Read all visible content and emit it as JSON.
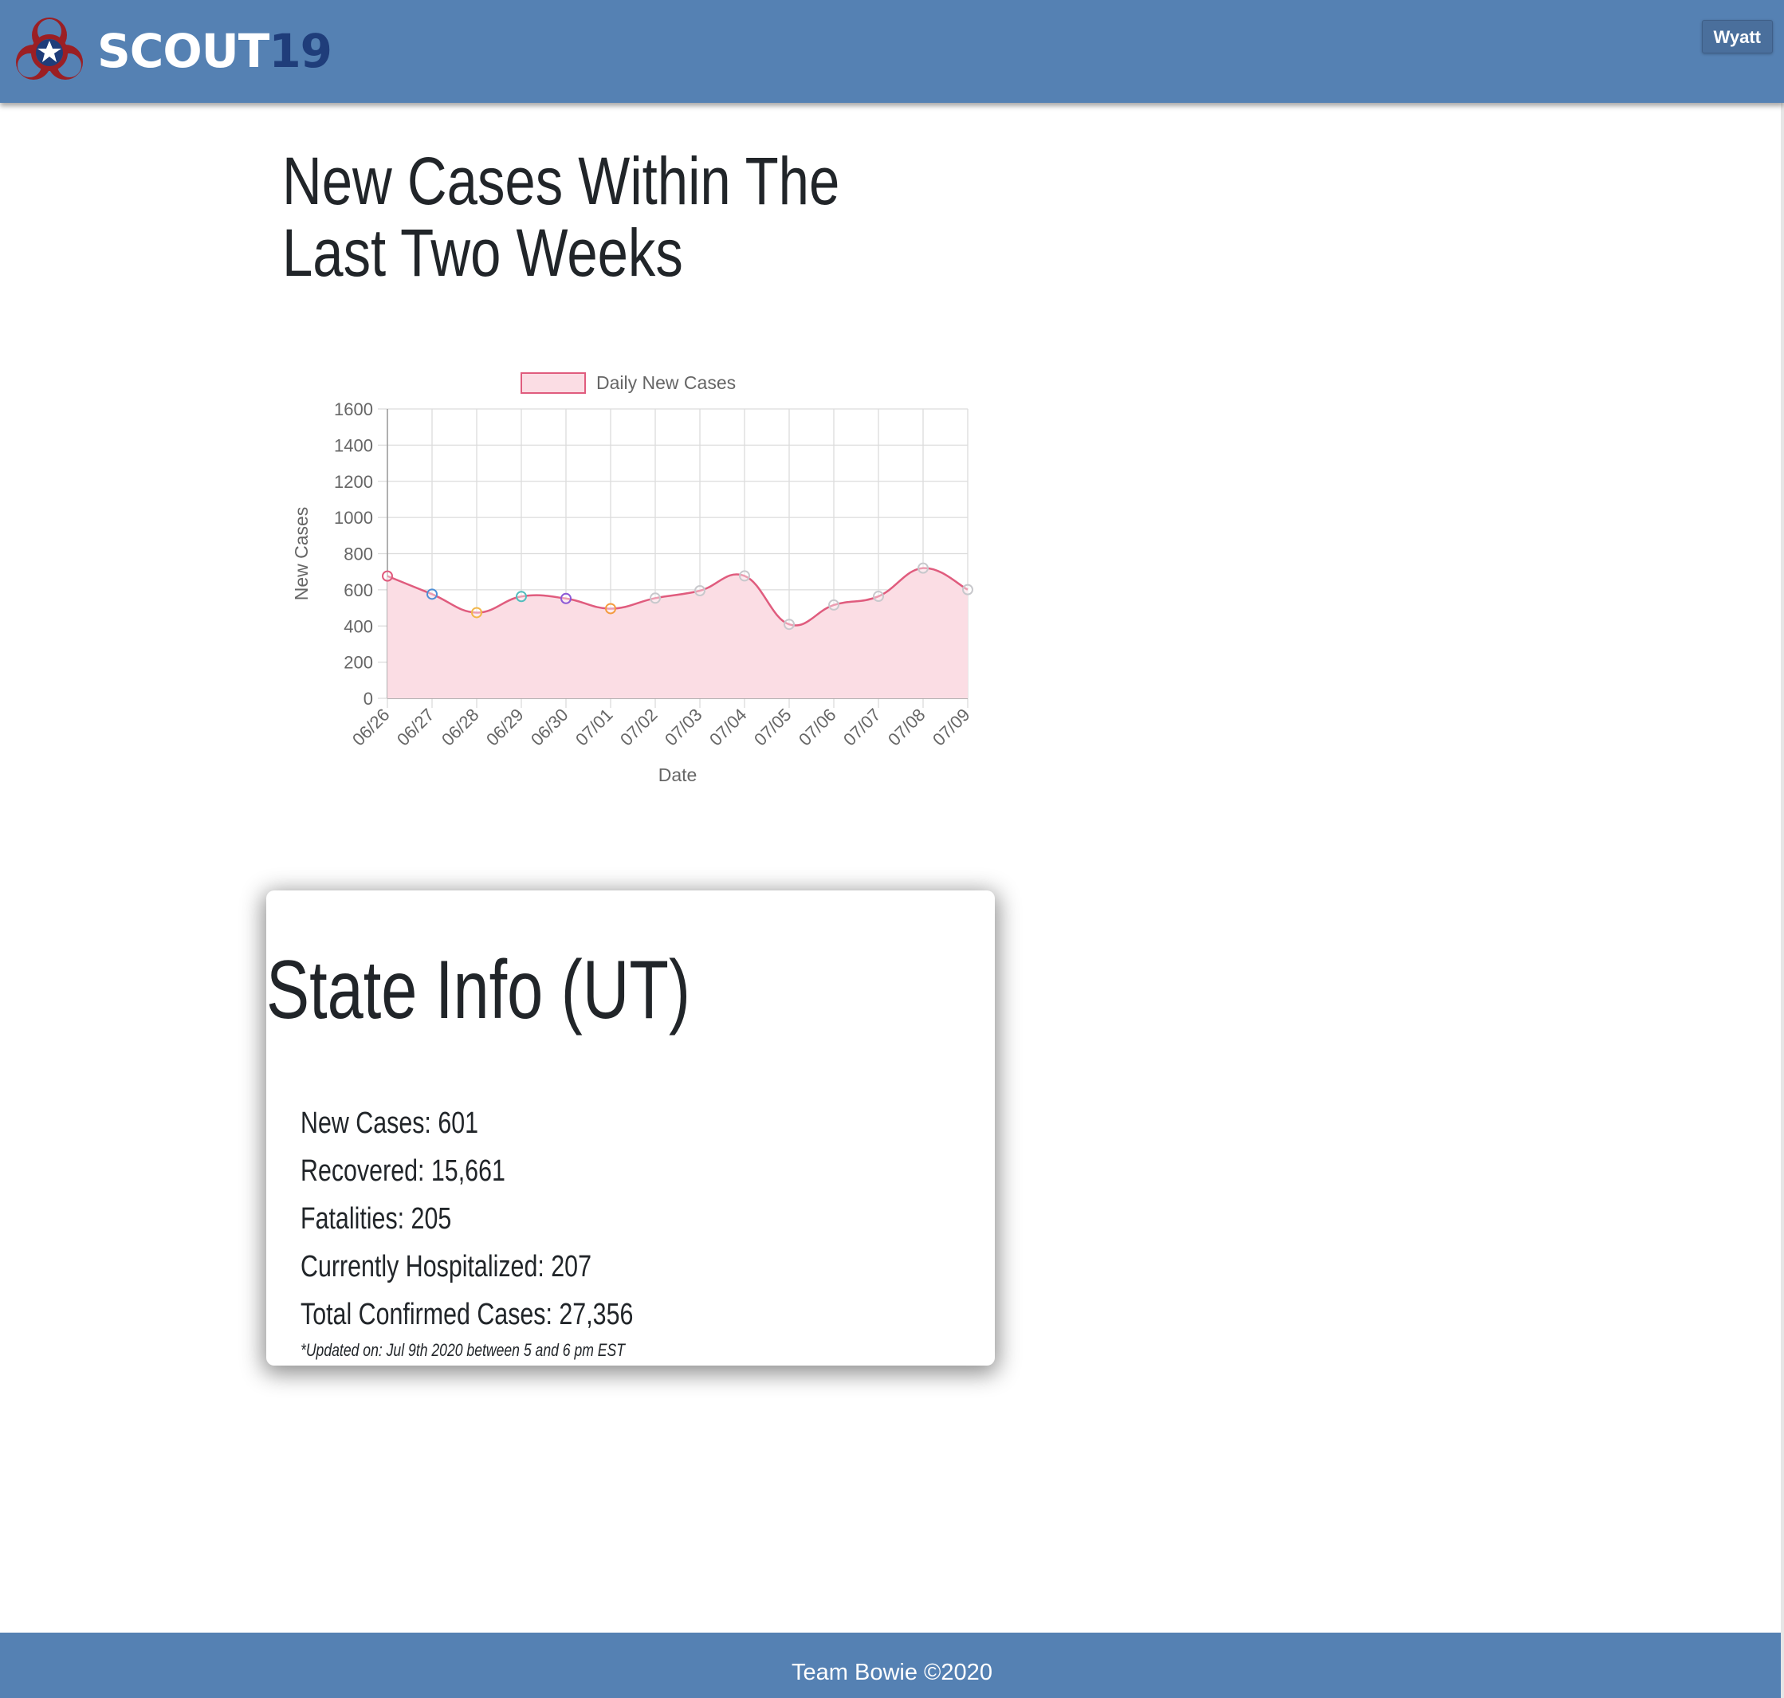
{
  "header": {
    "brand_text_scout": "SCOUT",
    "brand_text_num": "19",
    "brand_colors": {
      "bar": "#5581b3",
      "logo_red": "#9b1f24",
      "logo_blue": "#1f3d7a"
    },
    "user_button_label": "Wyatt"
  },
  "chart_section": {
    "heading": "New Cases Within The Last Two Weeks"
  },
  "chart_data": {
    "type": "area",
    "categories": [
      "06/26",
      "06/27",
      "06/28",
      "06/29",
      "06/30",
      "07/01",
      "07/02",
      "07/03",
      "07/04",
      "07/05",
      "07/06",
      "07/07",
      "07/08",
      "07/09"
    ],
    "series": [
      {
        "name": "Daily New Cases",
        "values": [
          676,
          576,
          474,
          563,
          552,
          496,
          554,
          595,
          677,
          409,
          516,
          564,
          720,
          601
        ],
        "line_color": "#e05c7e",
        "fill_color": "#fbdde4"
      }
    ],
    "point_colors": [
      "#e05c7e",
      "#4f8fd6",
      "#f2b64a",
      "#52bdbd",
      "#8d5ad6",
      "#f49b3f",
      "#c8c8cc",
      "#c8c8cc",
      "#c8c8cc",
      "#c8c8cc",
      "#c8c8cc",
      "#c8c8cc",
      "#c8c8cc",
      "#c8c8cc"
    ],
    "xlabel": "Date",
    "ylabel": "New Cases",
    "ylim": [
      0,
      1600
    ],
    "yticks": [
      "0",
      "200",
      "400",
      "600",
      "800",
      "1000",
      "1200",
      "1400",
      "1600"
    ],
    "grid": true,
    "legend_position": "top-center"
  },
  "state_info": {
    "title": "State Info (UT)",
    "new_cases": "New Cases: 601",
    "recovered": "Recovered: 15,661",
    "fatalities": "Fatalities: 205",
    "hospitalized": "Currently Hospitalized: 207",
    "total_confirmed": "Total Confirmed Cases: 27,356",
    "updated_note": "*Updated on: Jul 9th 2020 between 5 and 6 pm EST"
  },
  "footer": {
    "text": "Team Bowie ©2020"
  }
}
